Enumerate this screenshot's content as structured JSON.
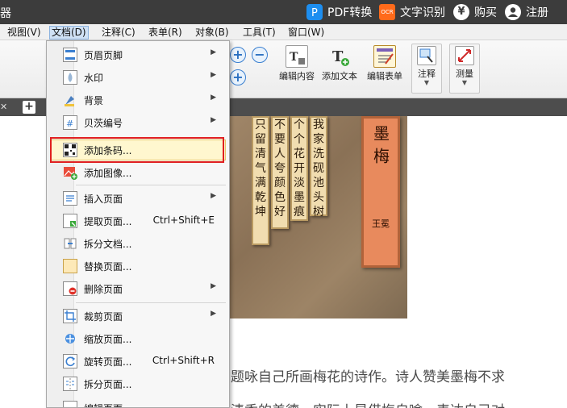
{
  "titlebar": {
    "app_title": "器",
    "pdf_convert": "PDF转换",
    "ocr": "文字识别",
    "ocr_badge": "OCR",
    "buy": "购买",
    "register": "注册",
    "currency_symbol": "¥"
  },
  "menubar": {
    "items": [
      "视图(V)",
      "文档(D)",
      "注释(C)",
      "表单(R)",
      "对象(B)",
      "工具(T)",
      "窗口(W)"
    ],
    "active": "文档(D)"
  },
  "toolbar": {
    "edit_content": "编辑内容",
    "add_text": "添加文本",
    "edit_form": "编辑表单",
    "comment": "注释",
    "measure": "测量"
  },
  "tabs": {
    "close_glyph": "✕",
    "new_tab_glyph": "+"
  },
  "document_menu": {
    "items": [
      {
        "label": "页眉页脚",
        "shortcut": "",
        "submenu": true
      },
      {
        "label": "水印",
        "shortcut": "",
        "submenu": true
      },
      {
        "label": "背景",
        "shortcut": "",
        "submenu": true
      },
      {
        "label": "贝茨编号",
        "shortcut": "",
        "submenu": true
      },
      {
        "label": "添加条码...",
        "shortcut": "",
        "submenu": false,
        "highlighted": true
      },
      {
        "label": "添加图像...",
        "shortcut": "",
        "submenu": false
      },
      {
        "label": "插入页面",
        "shortcut": "",
        "submenu": true
      },
      {
        "label": "提取页面...",
        "shortcut": "Ctrl+Shift+E",
        "submenu": false
      },
      {
        "label": "拆分文档...",
        "shortcut": "",
        "submenu": false
      },
      {
        "label": "替换页面...",
        "shortcut": "",
        "submenu": false
      },
      {
        "label": "删除页面",
        "shortcut": "",
        "submenu": true
      },
      {
        "label": "裁剪页面",
        "shortcut": "",
        "submenu": true
      },
      {
        "label": "缩放页面...",
        "shortcut": "",
        "submenu": false
      },
      {
        "label": "旋转页面...",
        "shortcut": "Ctrl+Shift+R",
        "submenu": false
      },
      {
        "label": "拆分页面...",
        "shortcut": "",
        "submenu": false
      },
      {
        "label": "编辑页面",
        "shortcut": "",
        "submenu": false
      }
    ],
    "submenu_arrow": "▶"
  },
  "document": {
    "painting": {
      "title": "墨梅",
      "author": "王冕",
      "poem_columns": [
        "我家洗砚池头树",
        "个个花开淡墨痕",
        "不要人夸颜色好",
        "只留清气满乾坤"
      ]
    },
    "body_line_1": "题咏自己所画梅花的诗作。诗人赞美墨梅不求",
    "body_line_2": "清香的美德，实际上是借梅自喻，表达自己对"
  },
  "colors": {
    "titlebar_bg": "#3c3c3c",
    "highlight_border": "#e02020",
    "title_scroll": "#e88a5d"
  }
}
